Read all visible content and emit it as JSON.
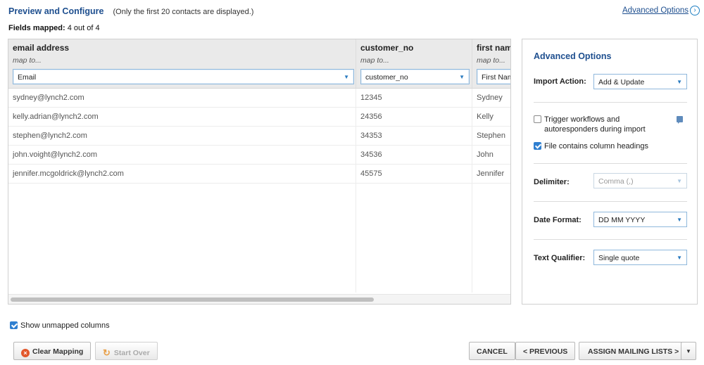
{
  "header": {
    "title": "Preview and Configure",
    "subtitle": "(Only the first 20 contacts are displayed.)",
    "advanced_link": "Advanced Options",
    "advanced_link_icon": "chevron-right-circle-icon"
  },
  "fields_mapped": {
    "label": "Fields mapped:",
    "value": "4 out of 4"
  },
  "grid": {
    "columns": [
      {
        "title": "email address",
        "sub": "map to...",
        "mapped": "Email"
      },
      {
        "title": "customer_no",
        "sub": "map to...",
        "mapped": "customer_no"
      },
      {
        "title": "first nam",
        "sub": "map to...",
        "mapped": "First Nam"
      }
    ],
    "rows": [
      [
        "sydney@lynch2.com",
        "12345",
        "Sydney"
      ],
      [
        "kelly.adrian@lynch2.com",
        "24356",
        "Kelly"
      ],
      [
        "stephen@lynch2.com",
        "34353",
        "Stephen"
      ],
      [
        "john.voight@lynch2.com",
        "34536",
        "John"
      ],
      [
        "jennifer.mcgoldrick@lynch2.com",
        "45575",
        "Jennifer"
      ]
    ]
  },
  "panel": {
    "title": "Advanced Options",
    "import_action": {
      "label": "Import Action:",
      "value": "Add & Update"
    },
    "trigger": {
      "line1": "Trigger workflows and",
      "line2": "autoresponders during import",
      "checked": false
    },
    "headings": {
      "label": "File contains column headings",
      "checked": true
    },
    "delimiter": {
      "label": "Delimiter:",
      "value": "Comma (,)"
    },
    "date_format": {
      "label": "Date Format:",
      "value": "DD MM YYYY"
    },
    "text_qualifier": {
      "label": "Text Qualifier:",
      "value": "Single quote"
    }
  },
  "show_unmapped": {
    "label": "Show unmapped columns",
    "checked": true
  },
  "buttons": {
    "clear_mapping": "Clear Mapping",
    "start_over": "Start Over",
    "cancel": "CANCEL",
    "previous": "< PREVIOUS",
    "assign": "ASSIGN MAILING LISTS >"
  },
  "colors": {
    "accent": "#1e4f8f",
    "select_border": "#8fb8dc",
    "checkbox": "#2f7fd0",
    "clear_icon": "#e2572b"
  }
}
